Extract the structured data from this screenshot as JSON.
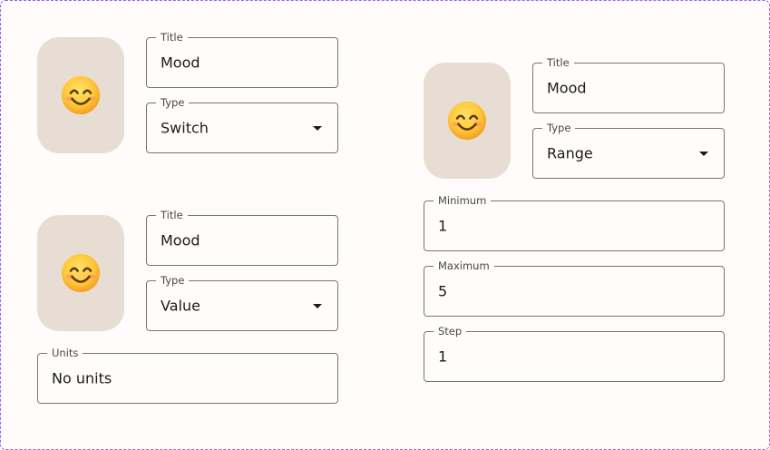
{
  "cards": [
    {
      "icon": "smiling-face-icon",
      "title_label": "Title",
      "title_value": "Mood",
      "type_label": "Type",
      "type_value": "Switch"
    },
    {
      "icon": "smiling-face-icon",
      "title_label": "Title",
      "title_value": "Mood",
      "type_label": "Type",
      "type_value": "Value",
      "units_label": "Units",
      "units_value": "No units"
    },
    {
      "icon": "smiling-face-icon",
      "title_label": "Title",
      "title_value": "Mood",
      "type_label": "Type",
      "type_value": "Range",
      "minimum_label": "Minimum",
      "minimum_value": "1",
      "maximum_label": "Maximum",
      "maximum_value": "5",
      "step_label": "Step",
      "step_value": "1"
    }
  ],
  "colors": {
    "icon_tile": "#e8ddd3",
    "outline": "#7b7570",
    "dashed_border": "#9b5cf0",
    "text": "#201a17",
    "label": "#4d4641"
  }
}
